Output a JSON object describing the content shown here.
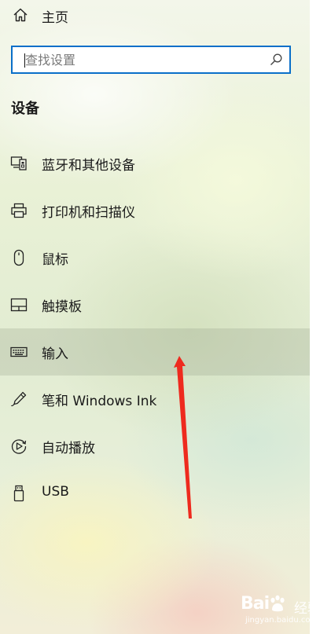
{
  "home": {
    "label": "主页",
    "icon": "home-icon"
  },
  "search": {
    "placeholder": "查找设置",
    "value": "",
    "icon": "search-icon"
  },
  "section": {
    "title": "设备"
  },
  "nav": {
    "items": [
      {
        "label": "蓝牙和其他设备",
        "icon": "bluetooth-devices-icon"
      },
      {
        "label": "打印机和扫描仪",
        "icon": "printer-icon"
      },
      {
        "label": "鼠标",
        "icon": "mouse-icon"
      },
      {
        "label": "触摸板",
        "icon": "touchpad-icon"
      },
      {
        "label": "输入",
        "icon": "keyboard-icon",
        "selected": true
      },
      {
        "label": "笔和 Windows Ink",
        "icon": "pen-icon"
      },
      {
        "label": "自动播放",
        "icon": "autoplay-icon"
      },
      {
        "label": "USB",
        "icon": "usb-icon"
      }
    ]
  },
  "watermark": {
    "brand": "Bai",
    "brand_suffix": "经验",
    "url": "jingyan.baidu.com"
  },
  "colors": {
    "accent": "#0a6fc9",
    "arrow": "#ee2a1e",
    "selected_bg": "rgba(150,160,140,0.28)"
  }
}
